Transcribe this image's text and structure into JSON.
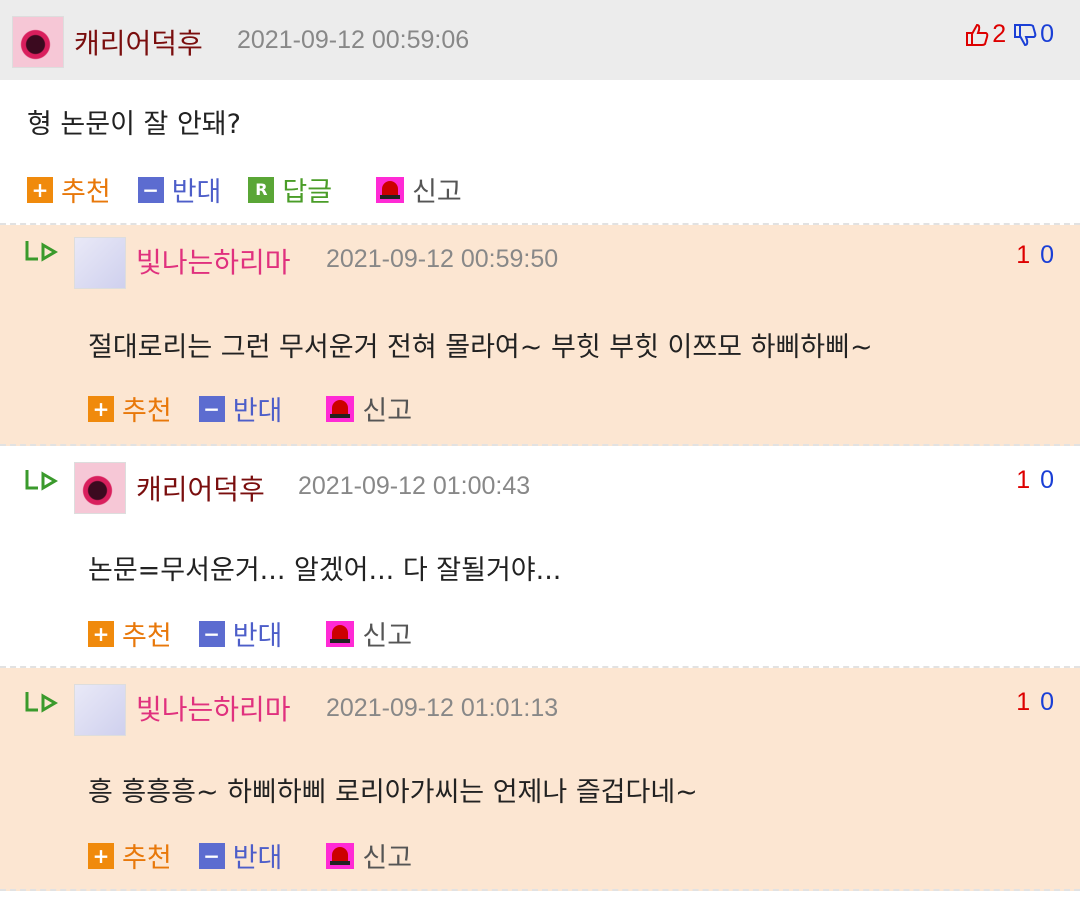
{
  "main_comment": {
    "nickname": "캐리어덕후",
    "date": "2021-09-12 00:59:06",
    "up_count": "2",
    "down_count": "0",
    "body": "형 논문이 잘 안돼?",
    "actions": {
      "recommend": "추천",
      "oppose": "반대",
      "reply": "답글",
      "report": "신고"
    }
  },
  "replies": [
    {
      "nickname": "빛나는하리마",
      "date": "2021-09-12 00:59:50",
      "up_count": "1",
      "down_count": "0",
      "body": "절대로리는 그런 무서운거 전혀 몰라여~ 부힛 부힛 이쯔모 하삐하삐~",
      "actions": {
        "recommend": "추천",
        "oppose": "반대",
        "report": "신고"
      }
    },
    {
      "nickname": "캐리어덕후",
      "date": "2021-09-12 01:00:43",
      "up_count": "1",
      "down_count": "0",
      "body": "논문=무서운거... 알겠어... 다 잘될거야...",
      "actions": {
        "recommend": "추천",
        "oppose": "반대",
        "report": "신고"
      }
    },
    {
      "nickname": "빛나는하리마",
      "date": "2021-09-12 01:01:13",
      "up_count": "1",
      "down_count": "0",
      "body": "흥 흥흥흥~ 하삐하삐 로리아가씨는 언제나 즐겁다네~",
      "actions": {
        "recommend": "추천",
        "oppose": "반대",
        "report": "신고"
      }
    }
  ],
  "icons": {
    "recommend": "plus-square-icon",
    "oppose": "minus-square-icon",
    "reply": "r-square-icon",
    "report": "siren-icon",
    "thumbs_up": "thumbs-up-icon",
    "thumbs_down": "thumbs-down-icon",
    "reply_arrow": "reply-arrow-icon"
  },
  "colors": {
    "header_bg": "#ececec",
    "reply_bg": "#fce6d2",
    "recommend": "#e8780a",
    "oppose": "#4d5ec9",
    "reply": "#4a9d28",
    "nick_dark": "#7a0e0e",
    "nick_pink": "#e0317e"
  }
}
